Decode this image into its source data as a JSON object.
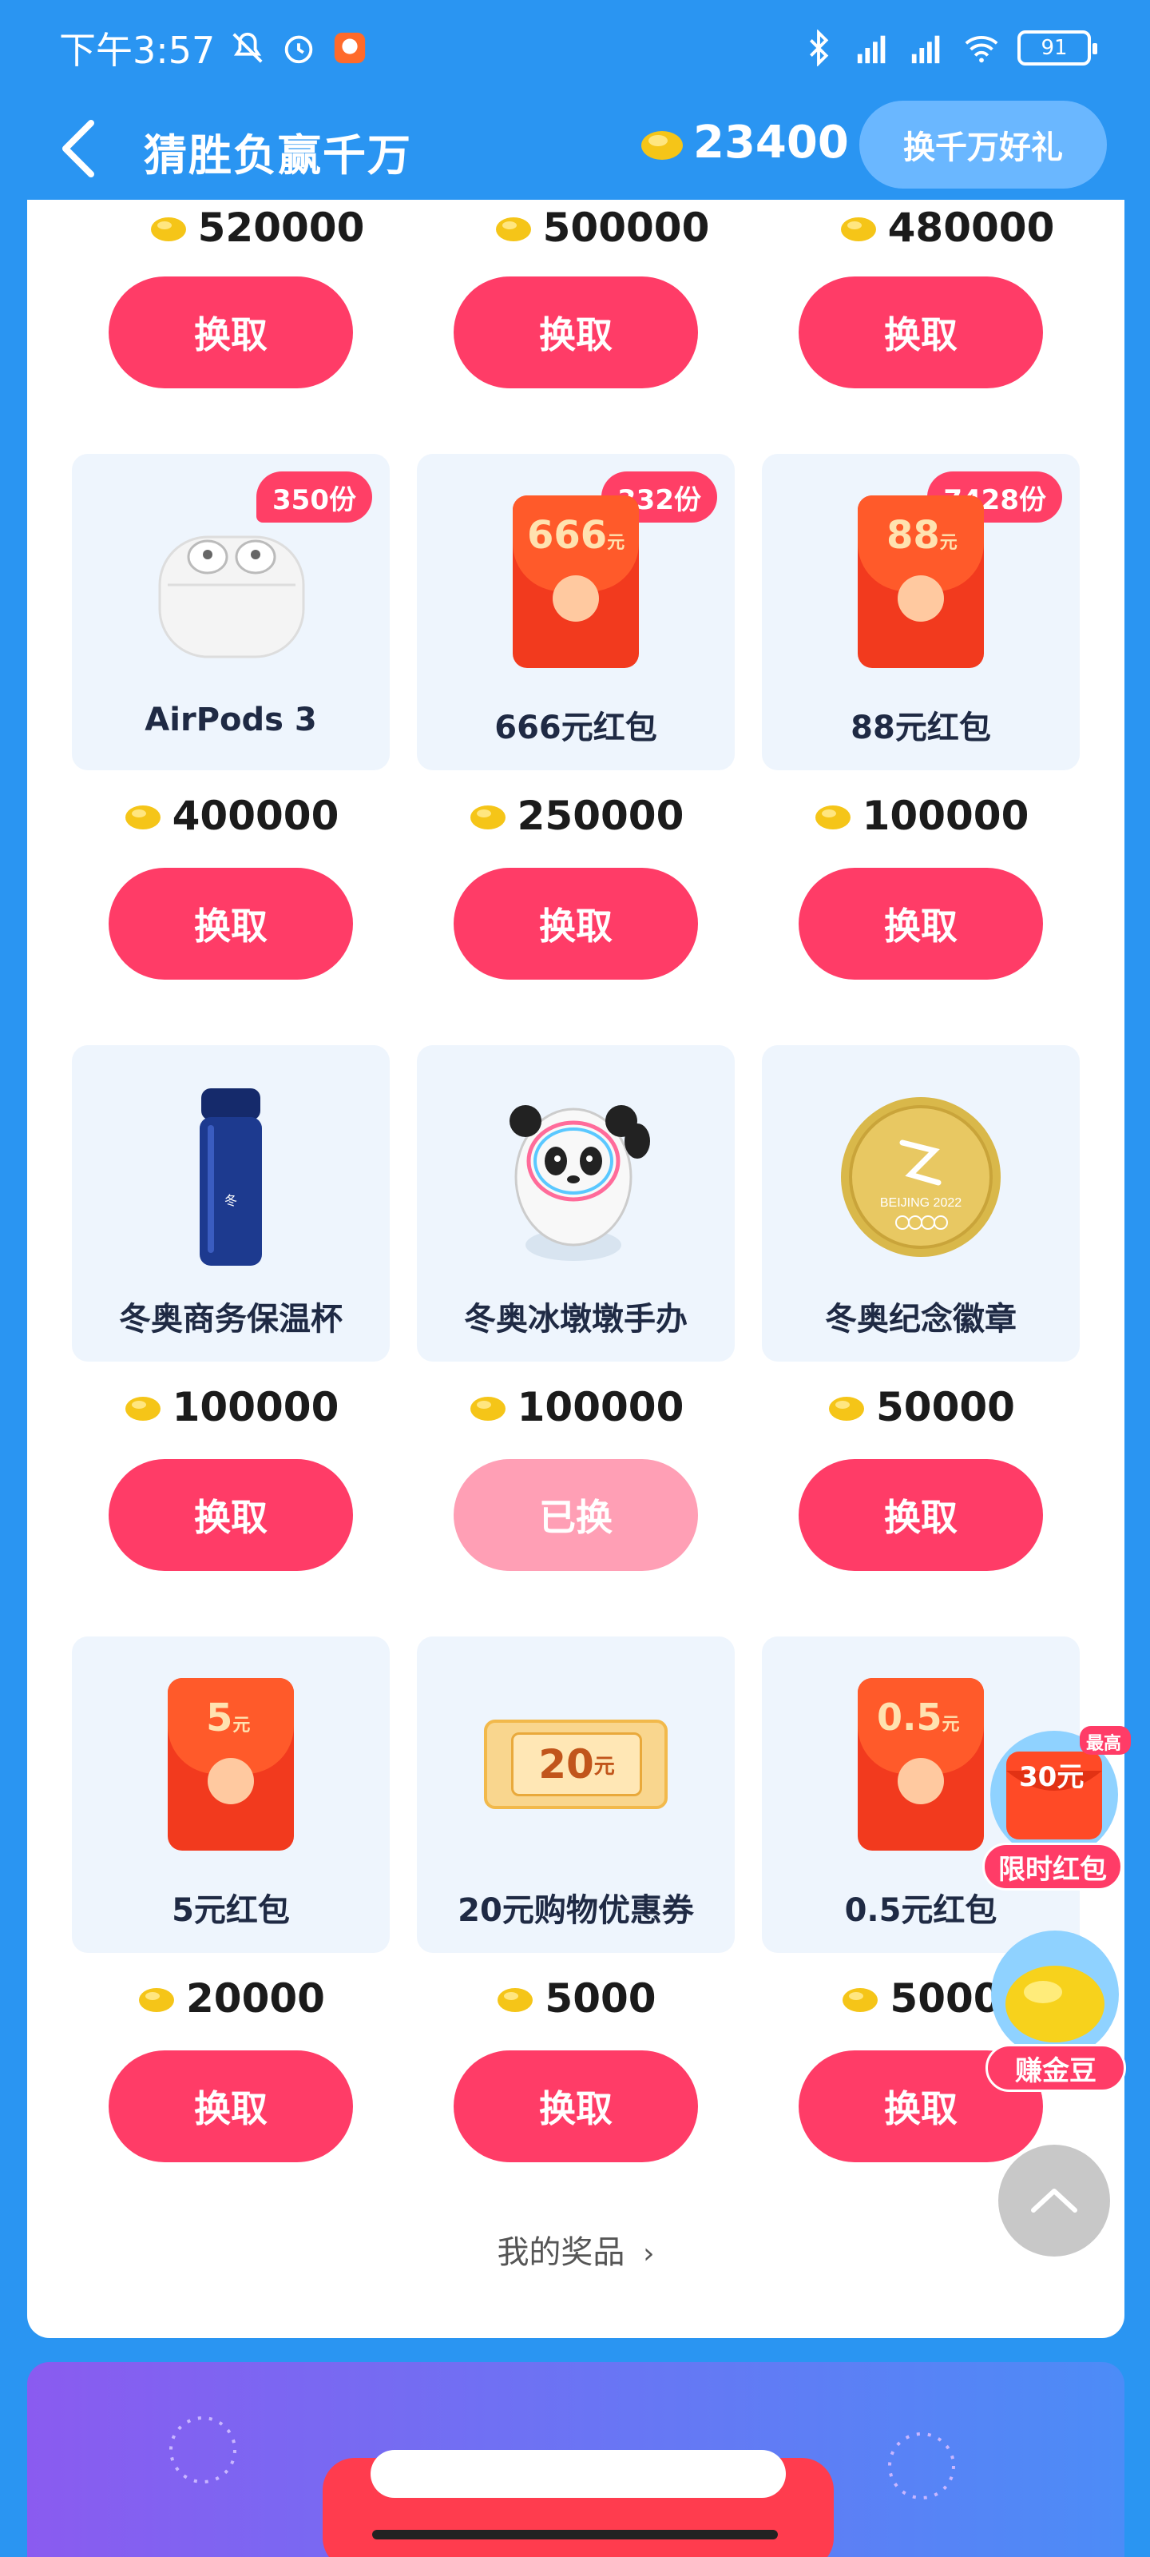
{
  "status_bar": {
    "time": "下午3:57",
    "battery": "91"
  },
  "header": {
    "title": "猜胜负赢千万",
    "balance": "23400",
    "exchange_button": "换千万好礼"
  },
  "top_row": {
    "prices": [
      "520000",
      "500000",
      "480000"
    ],
    "buttons": [
      "换取",
      "换取",
      "换取"
    ]
  },
  "rows": [
    {
      "items": [
        {
          "name": "AirPods 3",
          "badge": "350份",
          "price": "400000",
          "button": "换取",
          "status": "available"
        },
        {
          "name": "666元红包",
          "badge": "332份",
          "price": "250000",
          "button": "换取",
          "status": "available",
          "envelope_value": "666",
          "envelope_unit": "元"
        },
        {
          "name": "88元红包",
          "badge": "7428份",
          "price": "100000",
          "button": "换取",
          "status": "available",
          "envelope_value": "88",
          "envelope_unit": "元"
        }
      ]
    },
    {
      "items": [
        {
          "name": "冬奥商务保温杯",
          "price": "100000",
          "button": "换取",
          "status": "available"
        },
        {
          "name": "冬奥冰墩墩手办",
          "price": "100000",
          "button": "已换",
          "status": "exchanged"
        },
        {
          "name": "冬奥纪念徽章",
          "price": "50000",
          "button": "换取",
          "status": "available",
          "medal_text": "BEIJING 2022"
        }
      ]
    },
    {
      "items": [
        {
          "name": "5元红包",
          "price": "20000",
          "button": "换取",
          "status": "available",
          "envelope_value": "5",
          "envelope_unit": "元"
        },
        {
          "name": "20元购物优惠券",
          "price": "5000",
          "button": "换取",
          "status": "available",
          "coupon_value": "20",
          "coupon_unit": "元"
        },
        {
          "name": "0.5元红包",
          "price": "5000",
          "button": "换取",
          "status": "available",
          "envelope_value": "0.5",
          "envelope_unit": "元"
        }
      ]
    }
  ],
  "my_prizes_link": "我的奖品",
  "floating": {
    "red_packet": {
      "top_label": "最高",
      "amount": "30元",
      "tag": "限时红包"
    },
    "bean": {
      "tag": "赚金豆"
    }
  },
  "colors": {
    "background": "#2a95f2",
    "button": "#ff3c67",
    "button_done": "#ff9fb5",
    "card": "#eef5fd"
  }
}
